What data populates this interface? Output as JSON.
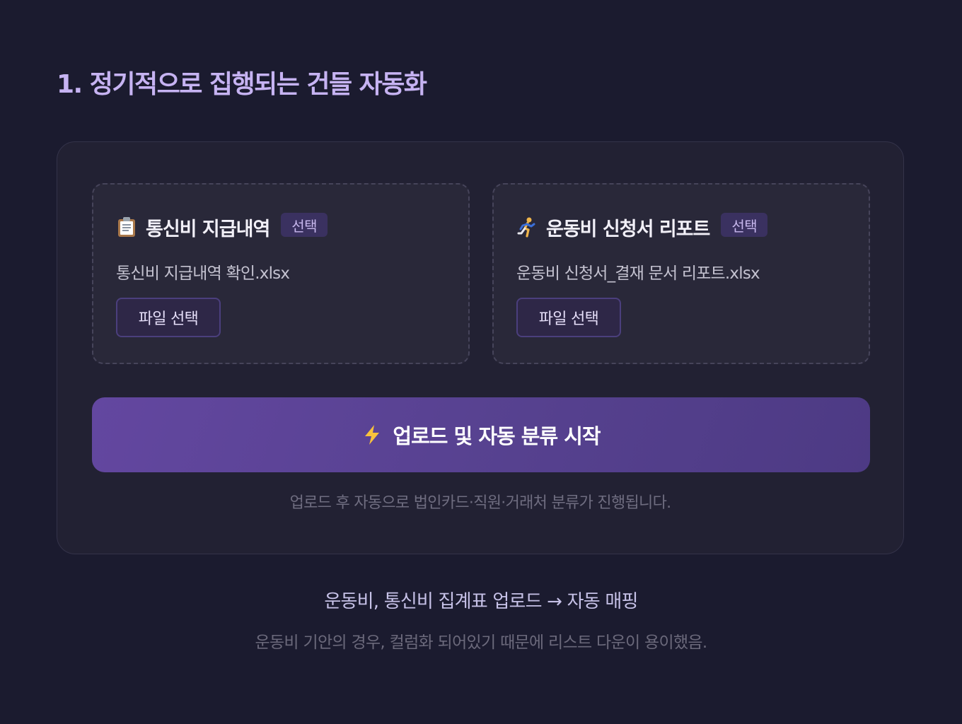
{
  "section": {
    "title": "1. 정기적으로 집행되는 건들 자동화"
  },
  "cards": [
    {
      "icon": "clipboard-icon",
      "title": "통신비 지급내역",
      "badge": "선택",
      "file_name": "통신비 지급내역 확인.xlsx",
      "button_label": "파일 선택"
    },
    {
      "icon": "running-person-icon",
      "title": "운동비 신청서 리포트",
      "badge": "선택",
      "file_name": "운동비 신청서_결재 문서 리포트.xlsx",
      "button_label": "파일 선택"
    }
  ],
  "action": {
    "icon": "lightning-icon",
    "label": "업로드 및 자동 분류 시작",
    "helper": "업로드 후 자동으로 법인카드·직원·거래처 분류가 진행됩니다."
  },
  "caption": {
    "main": "운동비, 통신비 집계표 업로드 → 자동 매핑",
    "sub": "운동비 기안의 경우, 컬럼화 되어있기 때문에 리스트 다운이 용이했음."
  },
  "colors": {
    "background": "#1b1b2f",
    "panel": "#222133",
    "accent": "#5b4394",
    "title": "#c6b3f2"
  }
}
